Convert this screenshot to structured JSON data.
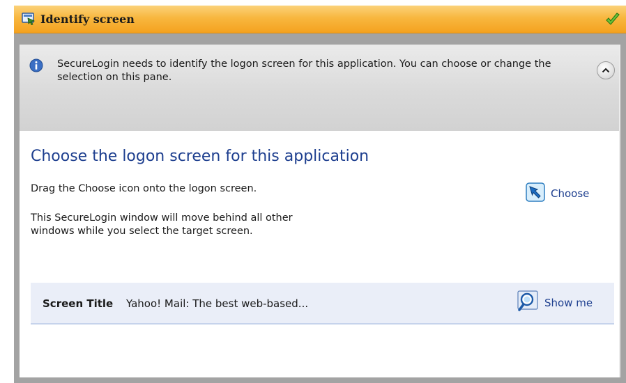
{
  "window": {
    "title": "Identify screen",
    "title_icon": "screen-select-icon",
    "status_icon": "green-checkmark-icon"
  },
  "info": {
    "icon": "info-icon",
    "text": "SecureLogin needs to identify the logon screen for this application. You can choose or change the selection on this pane.",
    "collapse_icon": "chevron-up-icon"
  },
  "section": {
    "heading": "Choose the logon screen for this application",
    "drag_instruction": "Drag the Choose icon onto the logon screen.",
    "move_note": "This SecureLogin window will move behind all other windows while you select the target screen.",
    "choose_label": "Choose",
    "choose_icon": "arrow-pointer-icon"
  },
  "screen": {
    "label": "Screen Title",
    "value": "Yahoo! Mail: The best web-based...",
    "show_me_label": "Show me",
    "show_me_icon": "magnifier-icon"
  },
  "colors": {
    "titlebar": "#f6ad2f",
    "link": "#1e3f8f",
    "heading": "#1e3f8f",
    "info_pane": "#dcdcdc",
    "screen_row": "#eaeef8"
  }
}
